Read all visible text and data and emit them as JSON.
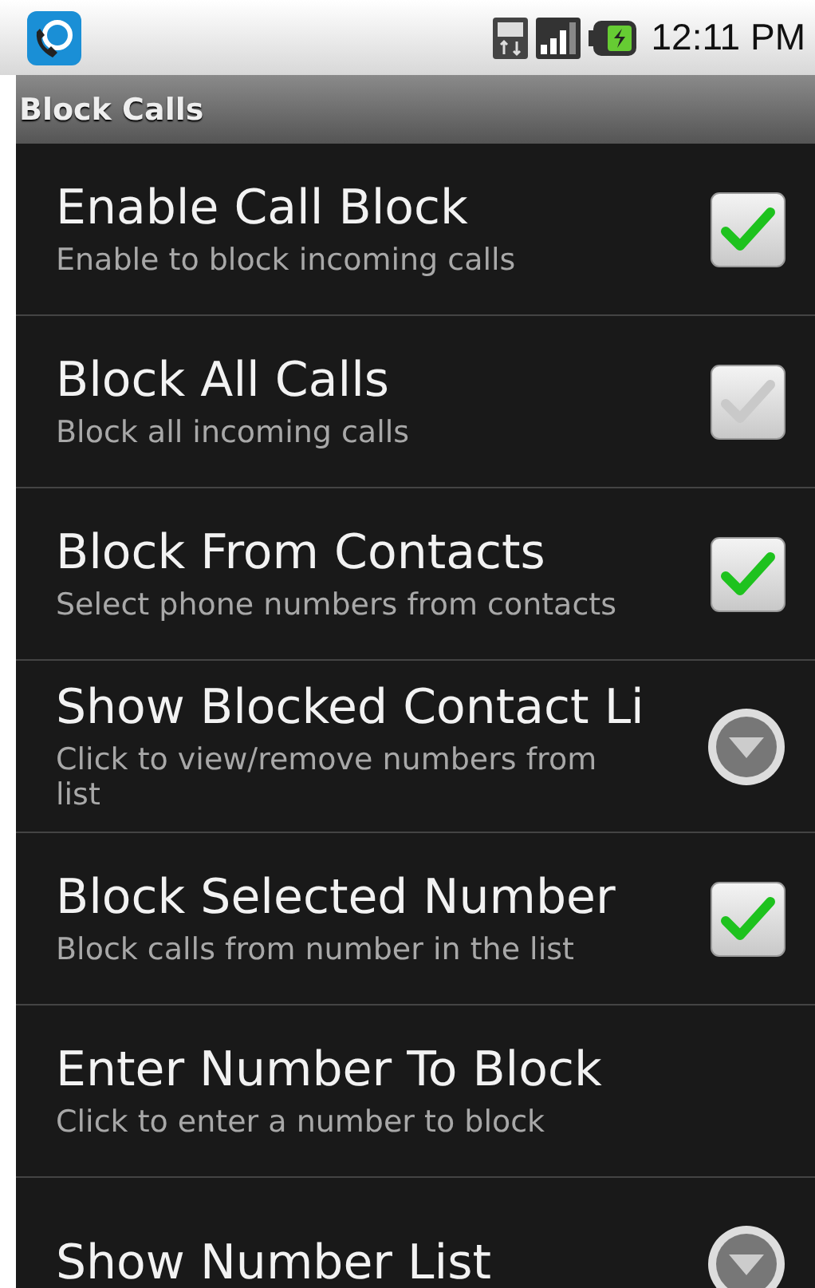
{
  "status_bar": {
    "time": "12:11 PM"
  },
  "title_bar": {
    "title": "Block Calls"
  },
  "settings": [
    {
      "title": "Enable Call Block",
      "summary": "Enable to block incoming calls",
      "kind": "checkbox",
      "checked": true
    },
    {
      "title": "Block All Calls",
      "summary": "Block all incoming calls",
      "kind": "checkbox",
      "checked": false
    },
    {
      "title": "Block From Contacts",
      "summary": "Select phone numbers from contacts",
      "kind": "checkbox",
      "checked": true
    },
    {
      "title": "Show Blocked Contact Li",
      "summary": "Click to view/remove numbers from list",
      "kind": "dropdown"
    },
    {
      "title": "Block Selected Number",
      "summary": "Block calls from number in the list",
      "kind": "checkbox",
      "checked": true
    },
    {
      "title": "Enter Number To Block",
      "summary": "Click to enter a number to block",
      "kind": "plain"
    },
    {
      "title": "Show Number List",
      "kind": "dropdown"
    }
  ]
}
